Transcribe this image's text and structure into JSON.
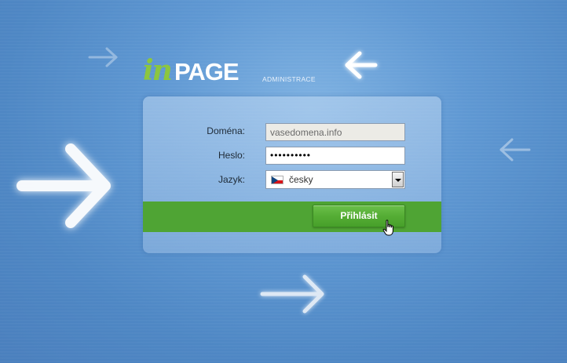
{
  "logo": {
    "prefix": "in",
    "main": "PAGE",
    "sub": "ADMINISTRACE"
  },
  "form": {
    "domain_label": "Doména:",
    "domain_value": "vasedomena.info",
    "password_label": "Heslo:",
    "password_value": "••••••••••",
    "language_label": "Jazyk:",
    "language_value": "česky",
    "login_button": "Přihlásit"
  },
  "colors": {
    "accent_green": "#4fa434",
    "logo_green": "#8cc63f",
    "background_blue": "#5f98d3"
  },
  "icons": [
    "arrow-right-icon",
    "arrow-left-icon",
    "czech-flag-icon",
    "dropdown-arrow-icon",
    "hand-cursor-icon"
  ]
}
